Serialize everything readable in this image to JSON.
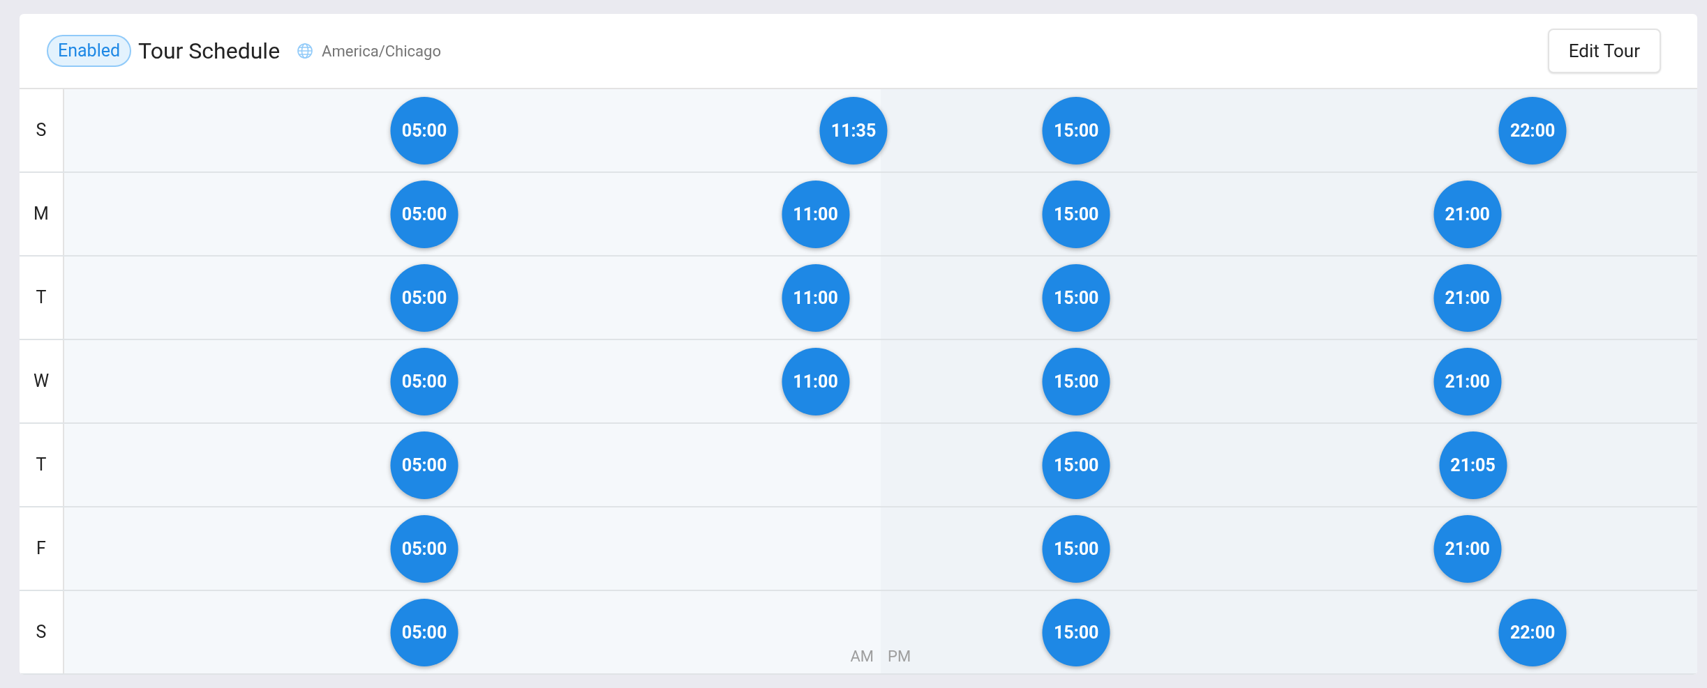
{
  "header": {
    "status": "Enabled",
    "title": "Tour Schedule",
    "timezone": "America/Chicago"
  },
  "edit_button": "Edit Tour",
  "days": [
    {
      "label": "S",
      "times": [
        "05:00",
        "11:35",
        "15:00",
        "22:00"
      ]
    },
    {
      "label": "M",
      "times": [
        "05:00",
        "11:00",
        "15:00",
        "21:00"
      ]
    },
    {
      "label": "T",
      "times": [
        "05:00",
        "11:00",
        "15:00",
        "21:00"
      ]
    },
    {
      "label": "W",
      "times": [
        "05:00",
        "11:00",
        "15:00",
        "21:00"
      ]
    },
    {
      "label": "T",
      "times": [
        "05:00",
        "15:00",
        "21:05"
      ]
    },
    {
      "label": "F",
      "times": [
        "05:00",
        "15:00",
        "21:00"
      ]
    },
    {
      "label": "S",
      "times": [
        "05:00",
        "15:00",
        "22:00"
      ]
    }
  ],
  "axis_labels": {
    "am": "AM",
    "pm": "PM"
  }
}
